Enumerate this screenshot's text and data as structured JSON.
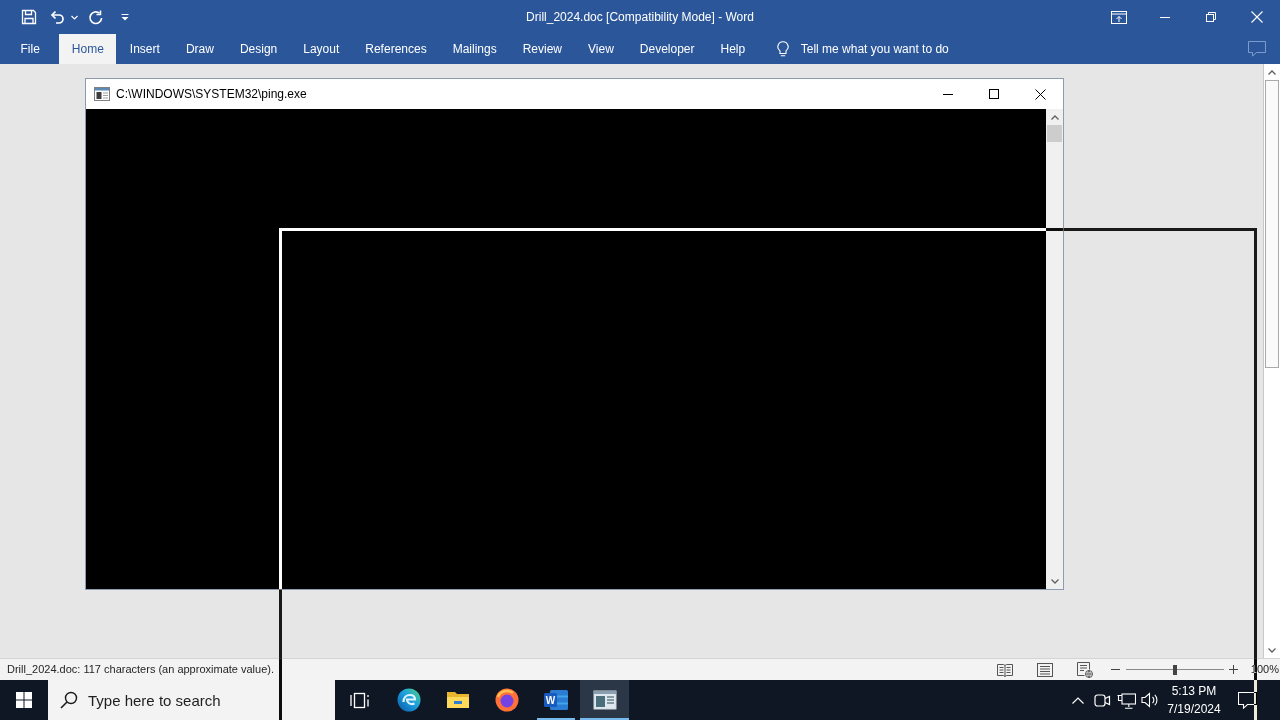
{
  "window": {
    "title": "Drill_2024.doc [Compatibility Mode] - Word"
  },
  "ribbon": {
    "tabs": [
      {
        "label": "File",
        "selected": false
      },
      {
        "label": "Home",
        "selected": true
      },
      {
        "label": "Insert",
        "selected": false
      },
      {
        "label": "Draw",
        "selected": false
      },
      {
        "label": "Design",
        "selected": false
      },
      {
        "label": "Layout",
        "selected": false
      },
      {
        "label": "References",
        "selected": false
      },
      {
        "label": "Mailings",
        "selected": false
      },
      {
        "label": "Review",
        "selected": false
      },
      {
        "label": "View",
        "selected": false
      },
      {
        "label": "Developer",
        "selected": false
      },
      {
        "label": "Help",
        "selected": false
      }
    ],
    "tell_me": {
      "placeholder": "Tell me what you want to do"
    }
  },
  "console_window": {
    "title": "C:\\WINDOWS\\SYSTEM32\\ping.exe"
  },
  "status_bar": {
    "message": "Drill_2024.doc: 117 characters (an approximate value).",
    "zoom_slider": {
      "level": 0.5
    },
    "zoom": "100%"
  },
  "taskbar": {
    "search": {
      "placeholder": "Type here to search"
    },
    "apps": [
      {
        "kind": "task_view",
        "running": false,
        "selected": false
      },
      {
        "kind": "edge",
        "running": false,
        "selected": false
      },
      {
        "kind": "explorer",
        "running": false,
        "selected": false
      },
      {
        "kind": "firefox",
        "running": false,
        "selected": false
      },
      {
        "kind": "word",
        "letter": "W",
        "running": true,
        "selected": false
      },
      {
        "kind": "console",
        "running": true,
        "selected": true
      }
    ],
    "clock": {
      "time": "5:13 PM",
      "date": "7/19/2024"
    }
  }
}
